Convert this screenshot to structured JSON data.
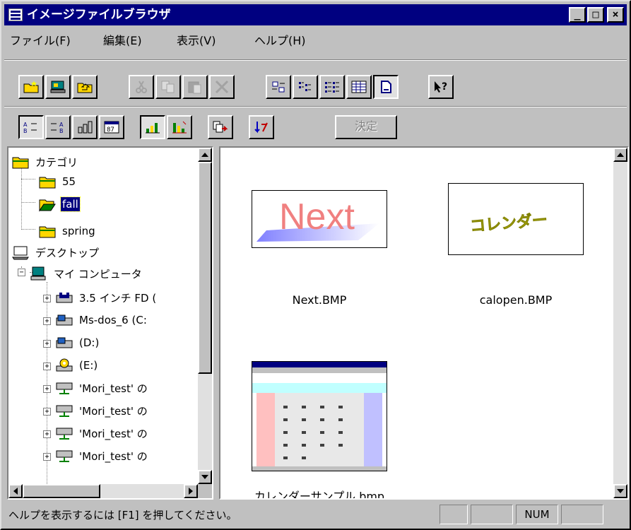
{
  "window": {
    "title": "イメージファイルブラウザ",
    "controls": {
      "minimize": "_",
      "maximize": "□",
      "close": "×"
    }
  },
  "menu": [
    "ファイル(F)",
    "編集(E)",
    "表示(V)",
    "ヘルプ(H)"
  ],
  "toolbar1": [
    {
      "icon": "new-folder-icon"
    },
    {
      "icon": "preview-icon"
    },
    {
      "icon": "up-folder-icon"
    },
    {
      "icon": "cut-icon",
      "disabled": true
    },
    {
      "icon": "copy-icon",
      "disabled": true
    },
    {
      "icon": "paste-icon",
      "disabled": true
    },
    {
      "icon": "delete-icon",
      "disabled": true
    },
    {
      "icon": "large-icons-view-icon"
    },
    {
      "icon": "small-icons-view-icon"
    },
    {
      "icon": "list-view-icon"
    },
    {
      "icon": "details-view-icon"
    },
    {
      "icon": "thumbnail-view-icon",
      "pressed": true
    },
    {
      "icon": "context-help-icon"
    }
  ],
  "toolbar2": {
    "buttons": [
      {
        "icon": "sort-by-name-icon",
        "pressed": true
      },
      {
        "icon": "sort-by-type-icon"
      },
      {
        "icon": "sort-by-size-icon"
      },
      {
        "icon": "sort-by-date-icon"
      },
      {
        "icon": "sort-ascending-icon",
        "pressed": true
      },
      {
        "icon": "sort-descending-icon"
      },
      {
        "icon": "export-icon"
      },
      {
        "icon": "import-icon"
      }
    ],
    "decide_label": "決定"
  },
  "tree": {
    "items": [
      {
        "label": "カテゴリ",
        "icon": "category-folder-icon"
      },
      {
        "label": "55",
        "icon": "folder-icon"
      },
      {
        "label": "fall",
        "icon": "open-folder-icon",
        "selected": true
      },
      {
        "label": "spring",
        "icon": "folder-icon"
      },
      {
        "label": "デスクトップ",
        "icon": "desktop-icon"
      },
      {
        "label": "マイ コンピュータ",
        "icon": "computer-icon"
      },
      {
        "label": "3.5 インチ FD (",
        "icon": "floppy-drive-icon"
      },
      {
        "label": "Ms-dos_6 (C:",
        "icon": "hard-drive-icon"
      },
      {
        "label": "(D:)",
        "icon": "hard-drive-icon"
      },
      {
        "label": "(E:)",
        "icon": "cdrom-drive-icon"
      },
      {
        "label": "'Mori_test' の",
        "icon": "network-drive-icon"
      },
      {
        "label": "'Mori_test' の",
        "icon": "network-drive-icon"
      },
      {
        "label": "'Mori_test' の",
        "icon": "network-drive-icon"
      },
      {
        "label": "'Mori_test' の",
        "icon": "network-drive-icon"
      }
    ]
  },
  "files": [
    {
      "name": "Next.BMP",
      "thumb_text": "Next"
    },
    {
      "name": "calopen.BMP",
      "thumb_text": "コレンダー"
    },
    {
      "name": "カレンダーサンプル.bmp"
    }
  ],
  "status": {
    "help_text": "ヘルプを表示するには [F1] を押してください。",
    "num": "NUM"
  },
  "colors": {
    "titlebar": "#000080",
    "face": "#c0c0c0",
    "selection": "#000080"
  }
}
